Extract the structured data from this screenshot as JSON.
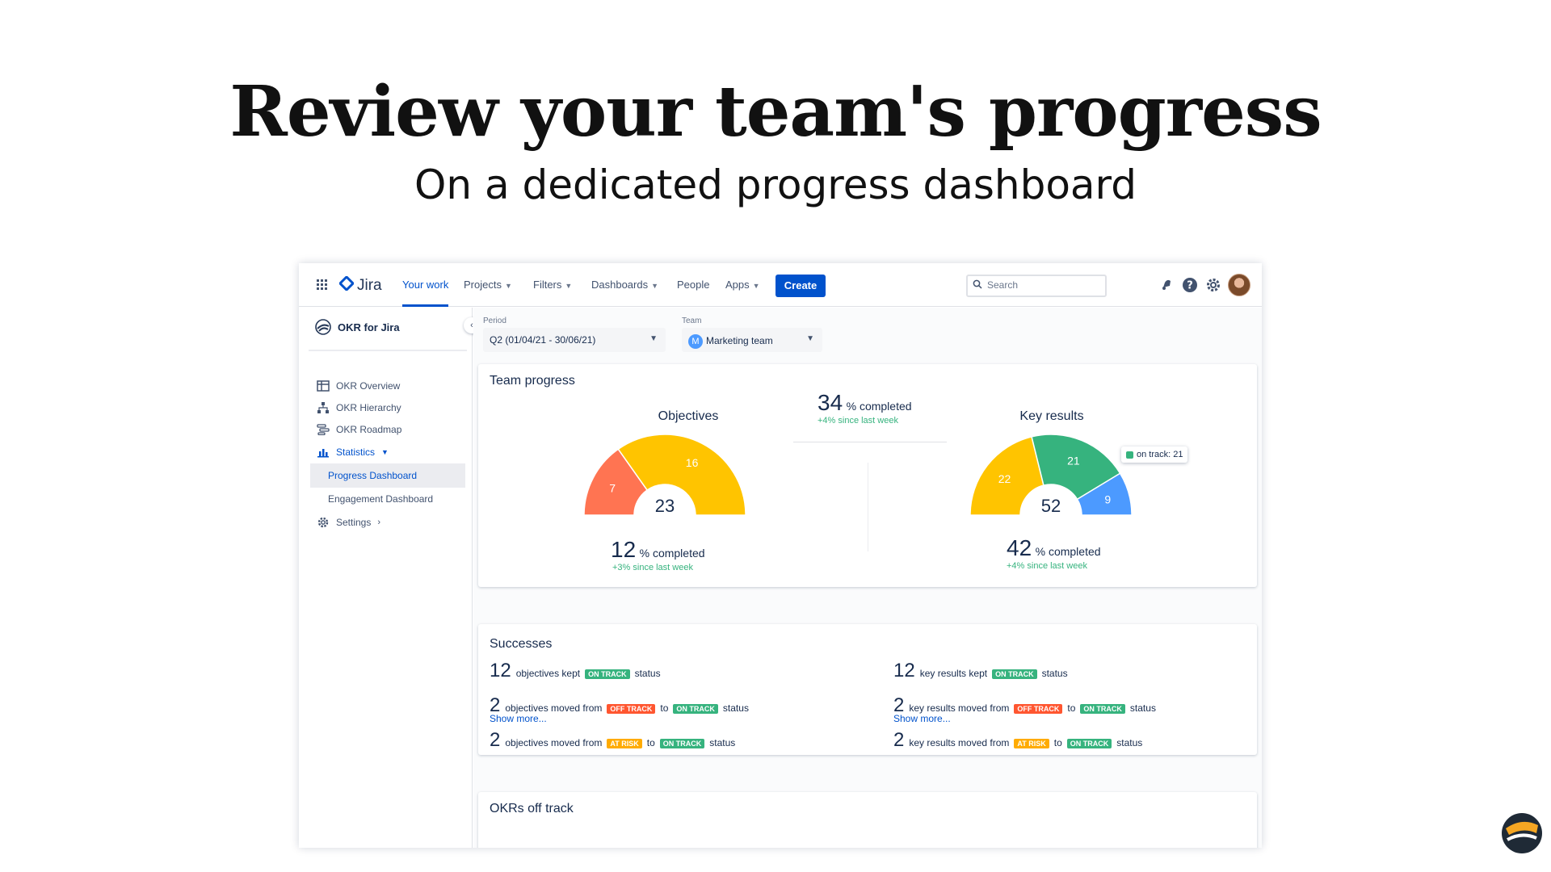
{
  "hero": {
    "title": "Review your team's progress",
    "subtitle": "On a dedicated progress dashboard"
  },
  "nav": {
    "logo": "Jira",
    "items": [
      "Your work",
      "Projects",
      "Filters",
      "Dashboards",
      "People",
      "Apps"
    ],
    "active": "Your work",
    "create": "Create",
    "search_placeholder": "Search",
    "icons": [
      "grid-icon",
      "bell-icon",
      "help-icon",
      "gear-icon",
      "avatar"
    ]
  },
  "sidebar": {
    "brand": "OKR for Jira",
    "items": [
      {
        "label": "OKR Overview",
        "icon": "table-icon"
      },
      {
        "label": "OKR Hierarchy",
        "icon": "hierarchy-icon"
      },
      {
        "label": "OKR Roadmap",
        "icon": "roadmap-icon"
      },
      {
        "label": "Statistics",
        "icon": "chart-icon"
      },
      {
        "label": "Progress Dashboard"
      },
      {
        "label": "Engagement Dashboard"
      },
      {
        "label": "Settings",
        "icon": "gear-icon"
      }
    ]
  },
  "filters": {
    "period_label": "Period",
    "period_value": "Q2 (01/04/21 - 30/06/21)",
    "team_label": "Team",
    "team_value": "Marketing team",
    "team_initial": "M"
  },
  "team_progress": {
    "title": "Team progress",
    "center": {
      "value": "34",
      "label": "% completed",
      "delta": "+4% since last week"
    },
    "objectives": {
      "title": "Objectives",
      "total": "23",
      "segments": [
        {
          "label": "7",
          "value": 7,
          "color": "#ff7452"
        },
        {
          "label": "16",
          "value": 16,
          "color": "#ffc400"
        }
      ],
      "pct": "12",
      "pct_label": "% completed",
      "delta": "+3% since last week"
    },
    "key_results": {
      "title": "Key results",
      "total": "52",
      "segments": [
        {
          "label": "22",
          "value": 22,
          "color": "#ffc400"
        },
        {
          "label": "21",
          "value": 21,
          "color": "#36b37e"
        },
        {
          "label": "9",
          "value": 9,
          "color": "#4c9aff"
        }
      ],
      "tooltip": "on track: 21",
      "pct": "42",
      "pct_label": "% completed",
      "delta": "+4% since last week"
    }
  },
  "successes": {
    "title": "Successes",
    "left": {
      "l1": {
        "n": "12",
        "a": "objectives kept",
        "s1": "ON TRACK",
        "b": "status"
      },
      "l2": {
        "n": "2",
        "a": "objectives moved from",
        "s1": "OFF TRACK",
        "to": "to",
        "s2": "ON TRACK",
        "b": "status"
      },
      "l3": {
        "n": "2",
        "a": "objectives moved from",
        "s1": "AT RISK",
        "to": "to",
        "s2": "ON TRACK",
        "b": "status"
      },
      "more": "Show more..."
    },
    "right": {
      "l1": {
        "n": "12",
        "a": "key results kept",
        "s1": "ON TRACK",
        "b": "status"
      },
      "l2": {
        "n": "2",
        "a": "key results moved from",
        "s1": "OFF TRACK",
        "to": "to",
        "s2": "ON TRACK",
        "b": "status"
      },
      "l3": {
        "n": "2",
        "a": "key results moved from",
        "s1": "AT RISK",
        "to": "to",
        "s2": "ON TRACK",
        "b": "status"
      },
      "more": "Show more..."
    }
  },
  "off_track": {
    "title": "OKRs off track"
  },
  "colors": {
    "brand_blue": "#0052cc",
    "on_track": "#36b37e",
    "off_track": "#ff5630",
    "at_risk": "#ffab00"
  }
}
